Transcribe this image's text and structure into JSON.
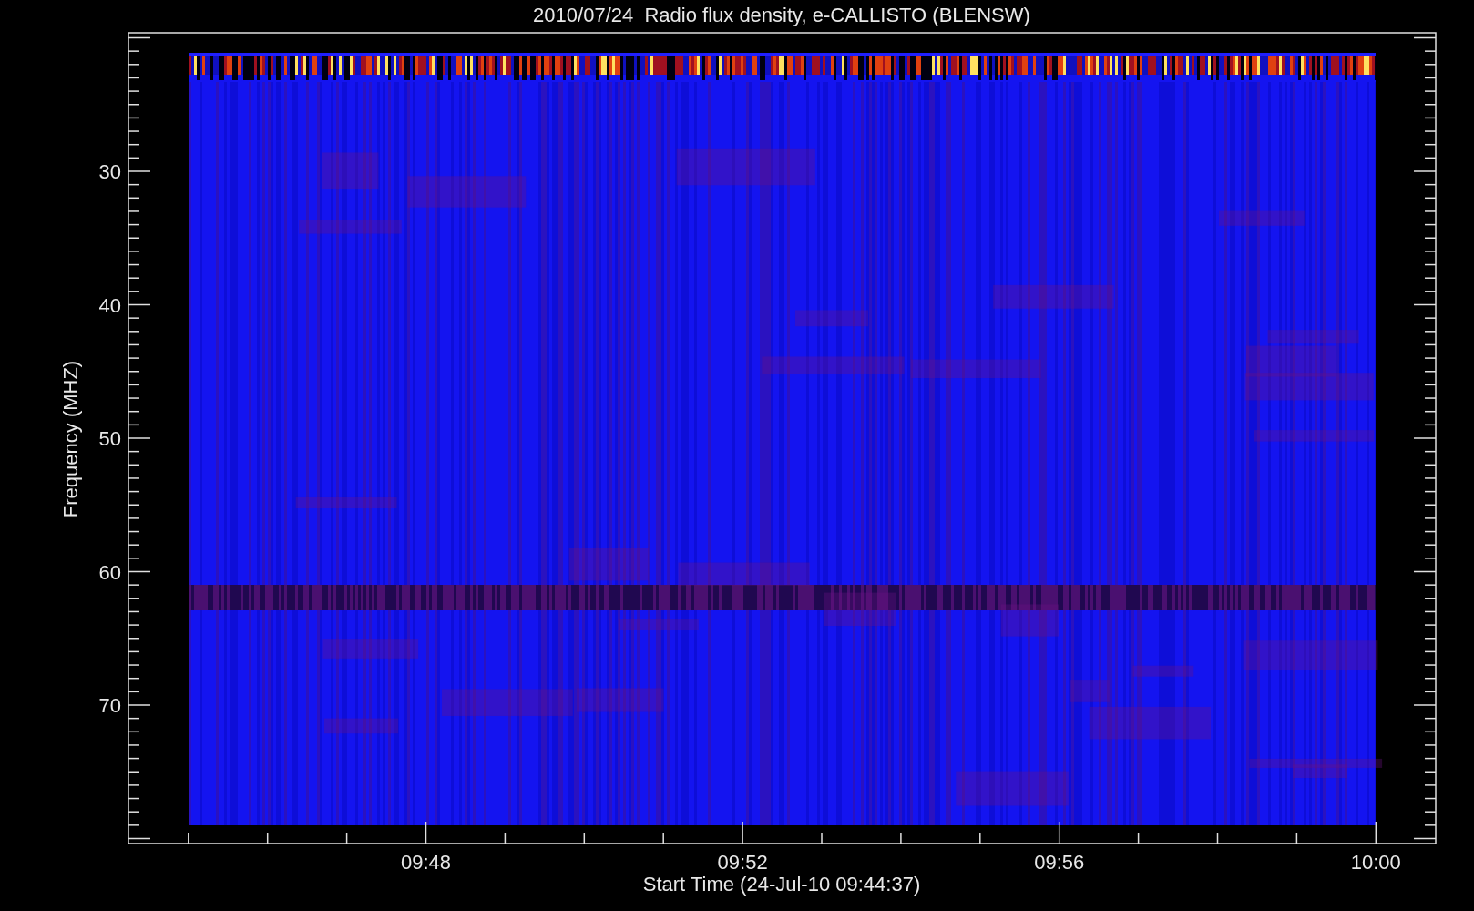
{
  "plot": {
    "title": "2010/07/24  Radio flux density, e-CALLISTO (BLENSW)",
    "xlabel": "Start Time (24-Jul-10 09:44:37)",
    "ylabel": "Frequency (MHZ)",
    "x_tick_labels": [
      "09:48",
      "09:52",
      "09:56",
      "10:00"
    ],
    "y_tick_labels": [
      "30",
      "40",
      "50",
      "60",
      "70"
    ]
  }
}
